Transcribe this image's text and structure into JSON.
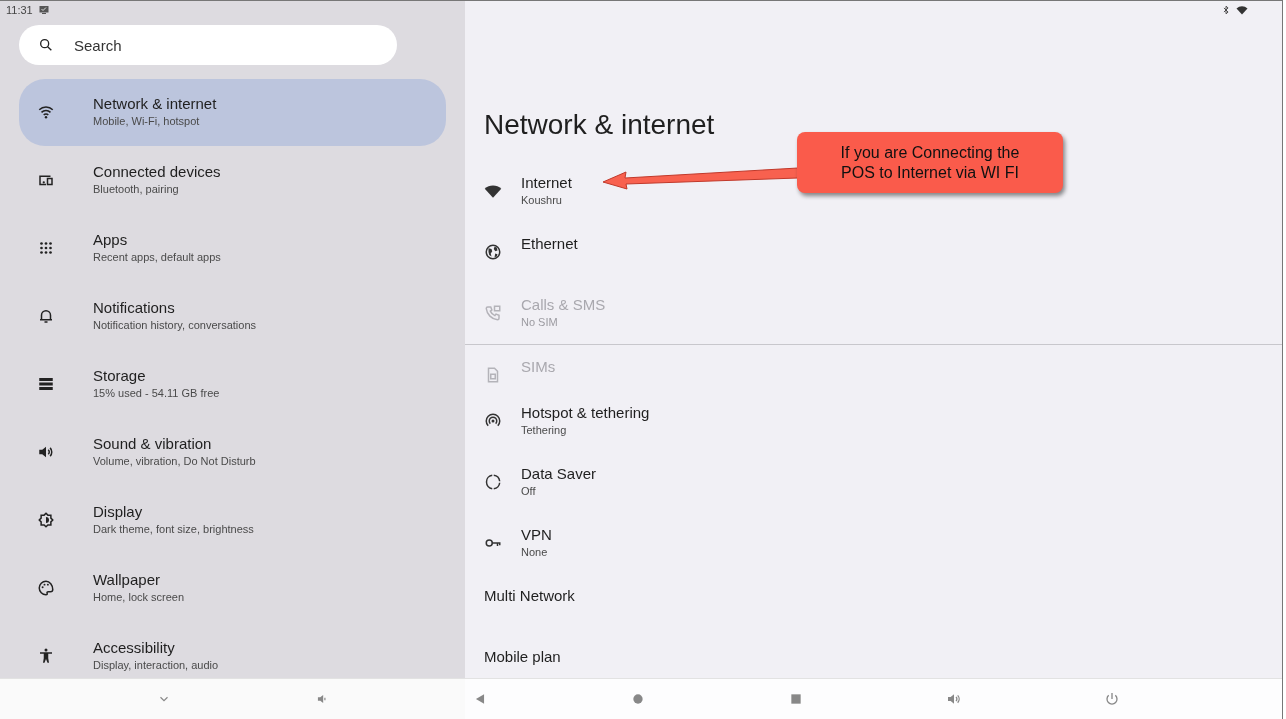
{
  "status_bar": {
    "time": "11:31"
  },
  "search": {
    "placeholder": "Search"
  },
  "sidebar": {
    "items": [
      {
        "title": "Network & internet",
        "subtitle": "Mobile, Wi-Fi, hotspot",
        "selected": true
      },
      {
        "title": "Connected devices",
        "subtitle": "Bluetooth, pairing",
        "selected": false
      },
      {
        "title": "Apps",
        "subtitle": "Recent apps, default apps",
        "selected": false
      },
      {
        "title": "Notifications",
        "subtitle": "Notification history, conversations",
        "selected": false
      },
      {
        "title": "Storage",
        "subtitle": "15% used - 54.11 GB free",
        "selected": false
      },
      {
        "title": "Sound & vibration",
        "subtitle": "Volume, vibration, Do Not Disturb",
        "selected": false
      },
      {
        "title": "Display",
        "subtitle": "Dark theme, font size, brightness",
        "selected": false
      },
      {
        "title": "Wallpaper",
        "subtitle": "Home, lock screen",
        "selected": false
      },
      {
        "title": "Accessibility",
        "subtitle": "Display, interaction, audio",
        "selected": false
      }
    ]
  },
  "page": {
    "title": "Network & internet",
    "sections": [
      [
        {
          "title": "Internet",
          "subtitle": "Koushru",
          "disabled": false
        },
        {
          "title": "Ethernet",
          "disabled": false
        },
        {
          "title": "Calls & SMS",
          "subtitle": "No SIM",
          "disabled": true
        }
      ],
      [
        {
          "title": "SIMs",
          "disabled": true
        },
        {
          "title": "Hotspot & tethering",
          "subtitle": "Tethering",
          "disabled": false
        },
        {
          "title": "Data Saver",
          "subtitle": "Off",
          "disabled": false
        },
        {
          "title": "VPN",
          "subtitle": "None",
          "disabled": false
        },
        {
          "title": "Multi Network",
          "disabled": false
        },
        {
          "title": "Mobile plan",
          "disabled": false
        }
      ]
    ]
  },
  "callout": {
    "text": "If you are Connecting the POS to Internet via WI FI"
  }
}
